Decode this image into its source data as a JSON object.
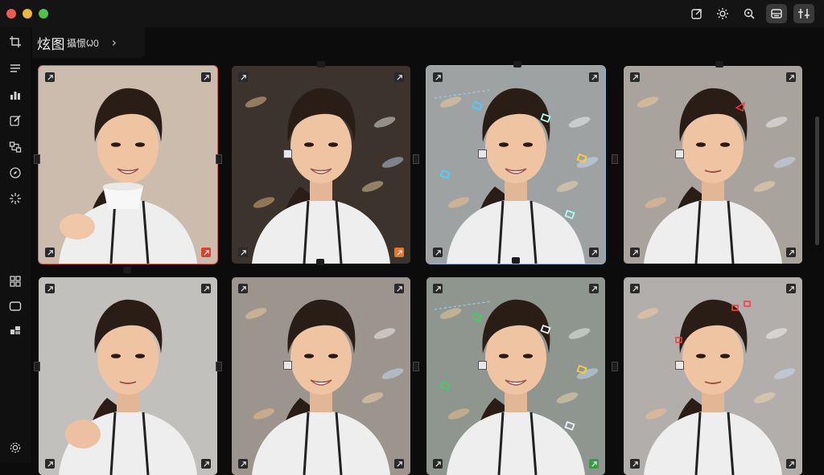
{
  "window": {
    "toolbar_icons": [
      "export-icon",
      "settings-gear-icon",
      "zoom-icon",
      "layout-icon",
      "magic-icon"
    ],
    "active_toolbar_icon": "layout-icon"
  },
  "sidebar": {
    "top_icons": [
      "crop-icon",
      "list-icon",
      "chart-icon",
      "edit-icon",
      "nodes-icon",
      "compass-icon",
      "sparkle-icon"
    ],
    "mid_icons": [
      "grid-icon",
      "frame-icon",
      "blocks-icon"
    ],
    "bottom_icon": "settings-icon"
  },
  "breadcrumb": {
    "title": "炫图",
    "subtitle": "攝憬ᱦ0",
    "chevron": "›"
  },
  "grid": {
    "cards": [
      {
        "id": 1,
        "variant": "cup",
        "bg": "#cbbcae",
        "state": "selected",
        "corner_br": "red"
      },
      {
        "id": 2,
        "variant": "smile-dark",
        "bg": "#3b332c",
        "state": "normal",
        "corner_br": "orange"
      },
      {
        "id": 3,
        "variant": "glitch",
        "bg": "#9ea2a2",
        "state": "hover",
        "corner_br": "normal"
      },
      {
        "id": 4,
        "variant": "plain",
        "bg": "#a9a39d",
        "state": "normal",
        "corner_br": "normal"
      },
      {
        "id": 5,
        "variant": "hand",
        "bg": "#c2c0bd",
        "state": "normal",
        "corner_br": "normal"
      },
      {
        "id": 6,
        "variant": "smile-light",
        "bg": "#9b958e",
        "state": "normal",
        "corner_br": "normal"
      },
      {
        "id": 7,
        "variant": "glitch-green",
        "bg": "#8f9690",
        "state": "normal",
        "corner_br": "green"
      },
      {
        "id": 8,
        "variant": "plain-red",
        "bg": "#b2aeab",
        "state": "normal",
        "corner_br": "normal"
      }
    ]
  },
  "colors": {
    "accent_red": "#d8432f",
    "accent_green": "#3c9a47",
    "hoodie": "#eeeeee",
    "hair": "#2a1d16"
  }
}
